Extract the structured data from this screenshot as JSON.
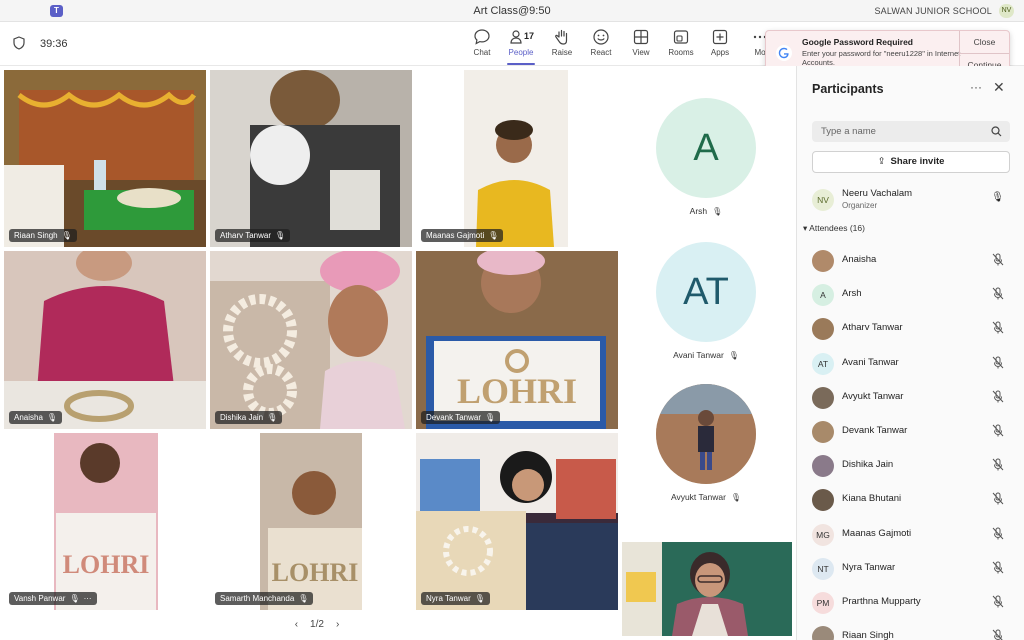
{
  "window": {
    "title": "Art Class@9:50",
    "org_name": "SALWAN JUNIOR SCHOOL",
    "user_initials": "NV"
  },
  "toolbar": {
    "timer": "39:36",
    "people_count": "17",
    "buttons": [
      {
        "label": "Chat",
        "icon": "chat-icon"
      },
      {
        "label": "People",
        "icon": "people-icon"
      },
      {
        "label": "Raise",
        "icon": "hand-icon"
      },
      {
        "label": "React",
        "icon": "smile-icon"
      },
      {
        "label": "View",
        "icon": "grid-icon"
      },
      {
        "label": "Rooms",
        "icon": "rooms-icon"
      },
      {
        "label": "Apps",
        "icon": "apps-icon"
      },
      {
        "label": "Mo",
        "icon": "more-icon"
      }
    ]
  },
  "notification": {
    "title": "Google Password Required",
    "body": "Enter your password for \"neeru1228\" in Internet Accounts.",
    "close_label": "Close",
    "continue_label": "Continue"
  },
  "stage": {
    "tiles": [
      {
        "name": "Riaan Singh"
      },
      {
        "name": "Atharv Tanwar"
      },
      {
        "name": "Maanas Gajmoti"
      },
      {
        "name": "Anaisha"
      },
      {
        "name": "Dishika Jain"
      },
      {
        "name": "Devank Tanwar"
      },
      {
        "name": "Vansh Panwar"
      },
      {
        "name": "Samarth Manchanda"
      },
      {
        "name": "Nyra Tanwar"
      }
    ],
    "avatars": [
      {
        "initials": "A",
        "name": "Arsh"
      },
      {
        "initials": "AT",
        "name": "Avani Tanwar"
      },
      {
        "initials": "",
        "name": "Avyukt Tanwar"
      }
    ],
    "lohri_text": "LOHRI",
    "pager": "1/2"
  },
  "panel": {
    "title": "Participants",
    "search_placeholder": "Type a name",
    "share_label": "Share invite",
    "organizer": {
      "name": "Neeru Vachalam",
      "role": "Organizer",
      "initials": "NV"
    },
    "attendees_label": "Attendees (16)",
    "attendees": [
      {
        "name": "Anaisha",
        "initials": "",
        "color": "#b08a6a"
      },
      {
        "name": "Arsh",
        "initials": "A",
        "color": "#d6efe2"
      },
      {
        "name": "Atharv Tanwar",
        "initials": "",
        "color": "#9a7a5a"
      },
      {
        "name": "Avani Tanwar",
        "initials": "AT",
        "color": "#d9f0f3"
      },
      {
        "name": "Avyukt Tanwar",
        "initials": "",
        "color": "#7a6a5a"
      },
      {
        "name": "Devank Tanwar",
        "initials": "",
        "color": "#a88a6a"
      },
      {
        "name": "Dishika Jain",
        "initials": "",
        "color": "#8a7a8a"
      },
      {
        "name": "Kiana Bhutani",
        "initials": "",
        "color": "#6a5a4a"
      },
      {
        "name": "Maanas Gajmoti",
        "initials": "MG",
        "color": "#f1e4e0"
      },
      {
        "name": "Nyra Tanwar",
        "initials": "NT",
        "color": "#dde8f1"
      },
      {
        "name": "Prarthna Mupparty",
        "initials": "PM",
        "color": "#f6dcdc"
      },
      {
        "name": "Riaan Singh",
        "initials": "",
        "color": "#9a8a7a"
      }
    ]
  }
}
